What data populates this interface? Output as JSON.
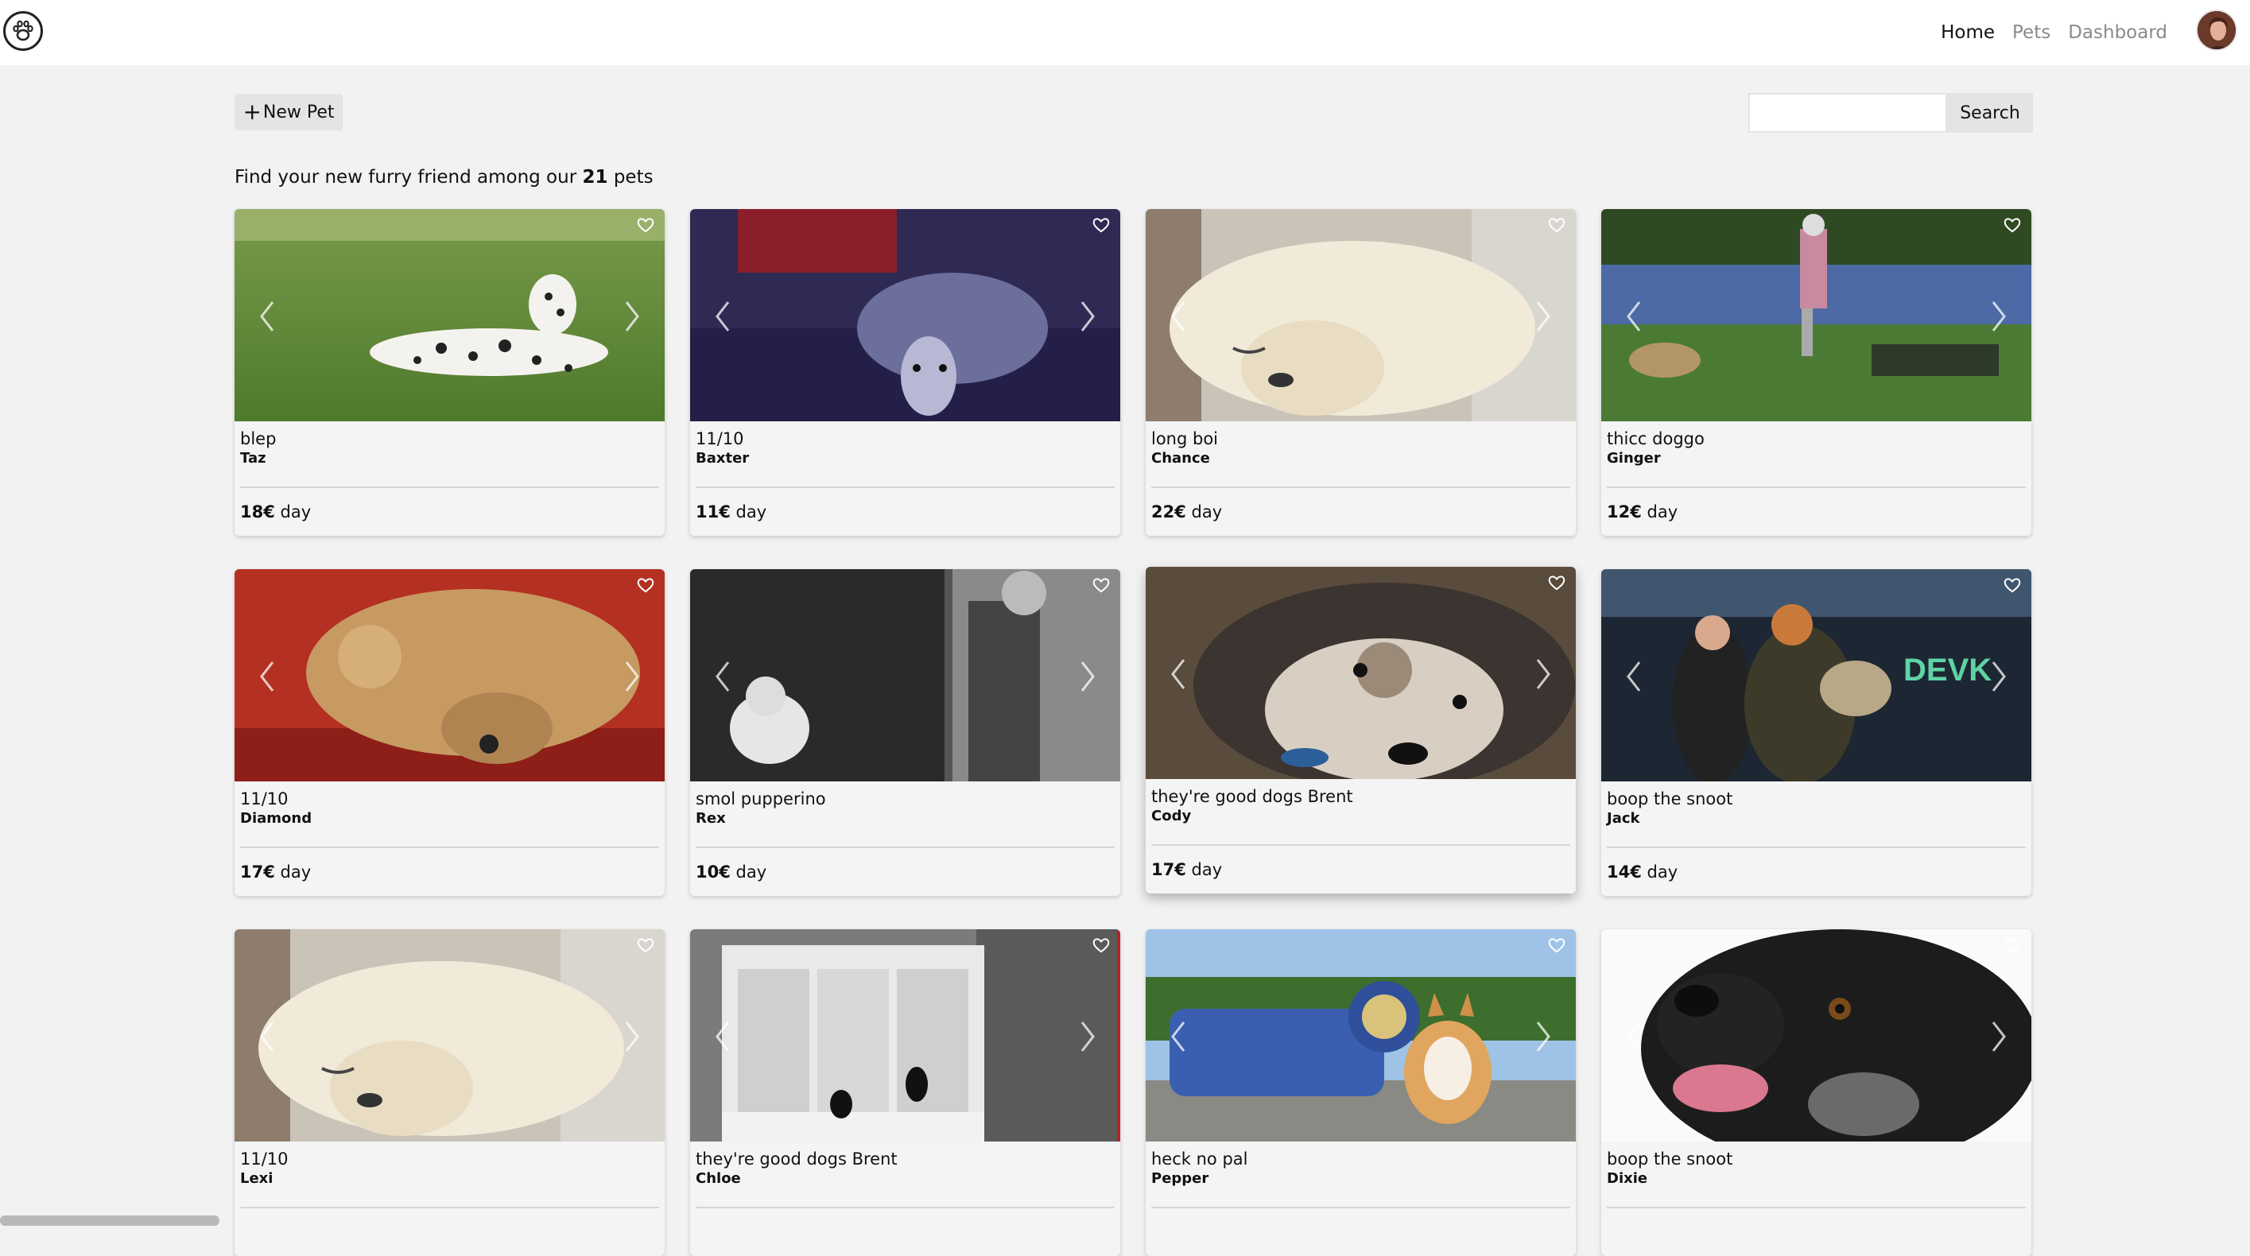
{
  "nav": {
    "links": [
      {
        "label": "Home",
        "active": true
      },
      {
        "label": "Pets",
        "active": false
      },
      {
        "label": "Dashboard",
        "active": false
      }
    ],
    "logo_icon": "paw-icon",
    "avatar_icon": "user-avatar"
  },
  "toolbar": {
    "new_pet_label": "New Pet",
    "search_placeholder": "",
    "search_value": "",
    "search_label": "Search"
  },
  "intro": {
    "prefix": "Find your new furry friend among our",
    "count": "21",
    "suffix": "pets"
  },
  "colors": {
    "page_bg": "#f2f2f2",
    "card_bg": "#f4f4f4",
    "button_bg": "#e4e4e4",
    "nav_inactive": "#8a8a8a"
  },
  "pets": [
    {
      "tagline": "blep",
      "name": "Taz",
      "price": "18€",
      "unit": "day",
      "scene": "dalmatian"
    },
    {
      "tagline": "11/10",
      "name": "Baxter",
      "price": "11€",
      "unit": "day",
      "scene": "whippet"
    },
    {
      "tagline": "long boi",
      "name": "Chance",
      "price": "22€",
      "unit": "day",
      "scene": "fluffy"
    },
    {
      "tagline": "thicc doggo",
      "name": "Ginger",
      "price": "12€",
      "unit": "day",
      "scene": "park"
    },
    {
      "tagline": "11/10",
      "name": "Diamond",
      "price": "17€",
      "unit": "day",
      "scene": "curly"
    },
    {
      "tagline": "smol pupperino",
      "name": "Rex",
      "price": "10€",
      "unit": "day",
      "scene": "bw"
    },
    {
      "tagline": "they're good dogs Brent",
      "name": "Cody",
      "price": "17€",
      "unit": "day",
      "scene": "husky"
    },
    {
      "tagline": "boop the snoot",
      "name": "Jack",
      "price": "14€",
      "unit": "day",
      "scene": "station"
    },
    {
      "tagline": "11/10",
      "name": "Lexi",
      "price": "",
      "unit": "",
      "scene": "fluffy"
    },
    {
      "tagline": "they're good dogs Brent",
      "name": "Chloe",
      "price": "",
      "unit": "",
      "scene": "window"
    },
    {
      "tagline": "heck no pal",
      "name": "Pepper",
      "price": "",
      "unit": "",
      "scene": "corgi"
    },
    {
      "tagline": "boop the snoot",
      "name": "Dixie",
      "price": "",
      "unit": "",
      "scene": "blackdog"
    }
  ]
}
